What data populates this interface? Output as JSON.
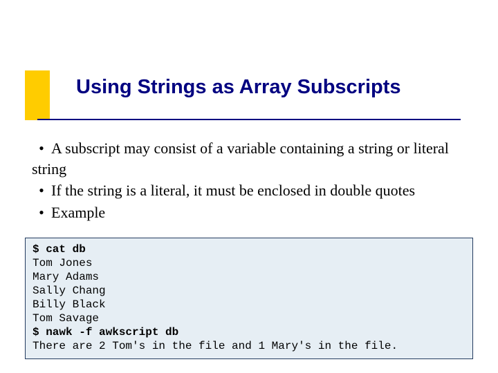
{
  "title": "Using Strings as Array Subscripts",
  "bullets": [
    "A subscript may consist of a variable containing a string or literal string",
    "If the string is a literal, it must be enclosed in double quotes",
    "Example"
  ],
  "code": {
    "cmd1": "$ cat db",
    "lines": [
      "Tom Jones",
      "Mary Adams",
      "Sally Chang",
      "Billy Black",
      "Tom Savage"
    ],
    "cmd2": "$ nawk -f awkscript db",
    "output": "There are 2 Tom's in the file and 1 Mary's in the file."
  }
}
